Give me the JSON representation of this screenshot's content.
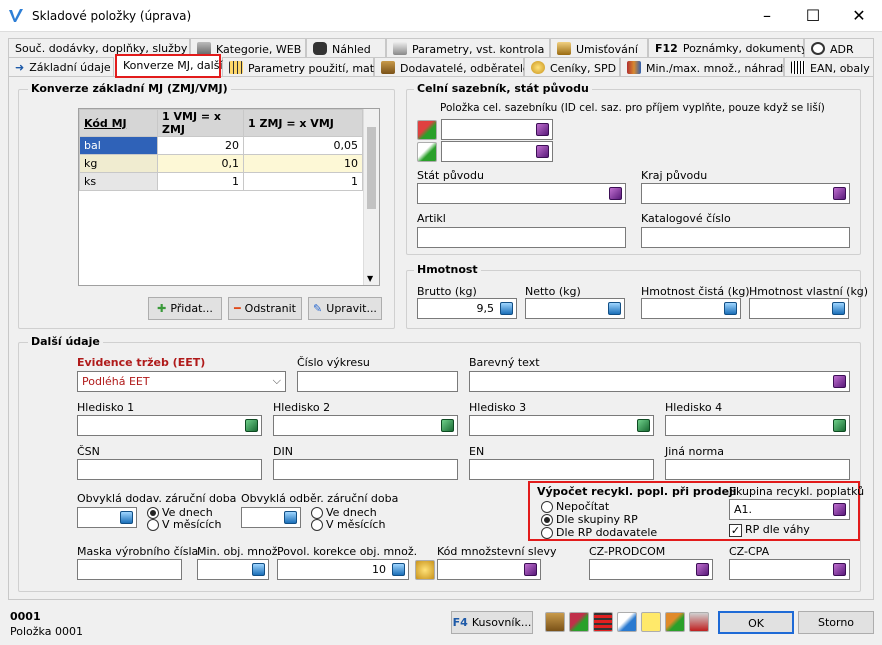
{
  "window": {
    "title": "Skladové položky (úprava)",
    "minimize": "–",
    "maximize": "☐",
    "close": "✕"
  },
  "tabs_row1": [
    {
      "label": "Souč. dodávky, doplňky, služby",
      "icon": "none"
    },
    {
      "label": "Kategorie, WEB",
      "icon": "category-icon"
    },
    {
      "label": "Náhled",
      "icon": "camera-icon"
    },
    {
      "label": "Parametry, vst. kontrola",
      "icon": "parameters-icon"
    },
    {
      "label": "Umisťování",
      "icon": "box-icon"
    },
    {
      "label": "Poznámky, dokumenty",
      "icon": "f12-icon",
      "prefix": "F12"
    },
    {
      "label": "ADR",
      "icon": "gauge-icon"
    }
  ],
  "tabs_row2": [
    {
      "label": "Základní údaje",
      "icon": "arrow-right-icon"
    },
    {
      "label": "Konverze MJ, další",
      "icon": "none",
      "active": true
    },
    {
      "label": "Parametry použití, matice",
      "icon": "grid-icon"
    },
    {
      "label": "Dodavatelé, odběratelé",
      "icon": "boxes-icon"
    },
    {
      "label": "Ceníky, SPD",
      "icon": "coins-icon"
    },
    {
      "label": "Min./max. množ., náhrady",
      "icon": "books-icon"
    },
    {
      "label": "EAN, obaly",
      "icon": "barcode-icon"
    }
  ],
  "conversion": {
    "title": "Konverze základní MJ  (ZMJ/VMJ)",
    "columns": [
      "Kód MJ",
      "1 VMJ = x ZMJ",
      "1 ZMJ = x VMJ"
    ],
    "rows": [
      {
        "code": "bal",
        "a": "20",
        "b": "0,05"
      },
      {
        "code": "kg",
        "a": "0,1",
        "b": "10"
      },
      {
        "code": "ks",
        "a": "1",
        "b": "1"
      }
    ],
    "add_button": "Přidat...",
    "remove_button": "Odstranit",
    "edit_button": "Upravit..."
  },
  "customs": {
    "title": "Celní sazebník, stát původu",
    "hint": "Položka cel. sazebníku (ID cel. saz. pro příjem vyplňte, pouze když se liší)",
    "country_label": "Stát původu",
    "region_label": "Kraj původu",
    "article_label": "Artikl",
    "catalog_label": "Katalogové číslo"
  },
  "weight": {
    "title": "Hmotnost",
    "gross_label": "Brutto (kg)",
    "gross_value": "9,5",
    "net_label": "Netto (kg)",
    "pure_label": "Hmotnost čistá (kg)",
    "own_label": "Hmotnost vlastní (kg)"
  },
  "other": {
    "title": "Další údaje",
    "eet_label": "Evidence tržeb (EET)",
    "eet_value": "Podléhá EET",
    "drawing_label": "Číslo výkresu",
    "color_label": "Barevný text",
    "h1": "Hledisko 1",
    "h2": "Hledisko 2",
    "h3": "Hledisko 3",
    "h4": "Hledisko 4",
    "csn": "ČSN",
    "din": "DIN",
    "en": "EN",
    "other_norm": "Jiná norma",
    "supply_warranty": "Obvyklá dodav. záruční doba",
    "customer_warranty": "Obvyklá odběr. záruční doba",
    "in_days": "Ve dnech",
    "in_months": "V měsících",
    "mask_label": "Maska výrobního čísla",
    "min_qty_label": "Min. obj. množ.",
    "correction_label": "Povol. korekce obj. množ.",
    "correction_value": "10",
    "discount_label": "Kód množstevní slevy",
    "prodcom_label": "CZ-PRODCOM",
    "cpa_label": "CZ-CPA"
  },
  "recycle": {
    "title": "Výpočet recykl. popl. při prodeji",
    "options": [
      "Nepočítat",
      "Dle skupiny RP",
      "Dle RP dodavatele"
    ],
    "selected": 1,
    "group_label": "Skupina recykl. poplatků",
    "group_value": "A1.",
    "by_weight_label": "RP dle váhy",
    "by_weight_checked": "✓"
  },
  "footer": {
    "code": "0001",
    "name": "Položka 0001",
    "bom_button": "Kusovník...",
    "bom_key": "F4",
    "ok_button": "OK",
    "cancel_button": "Storno"
  }
}
